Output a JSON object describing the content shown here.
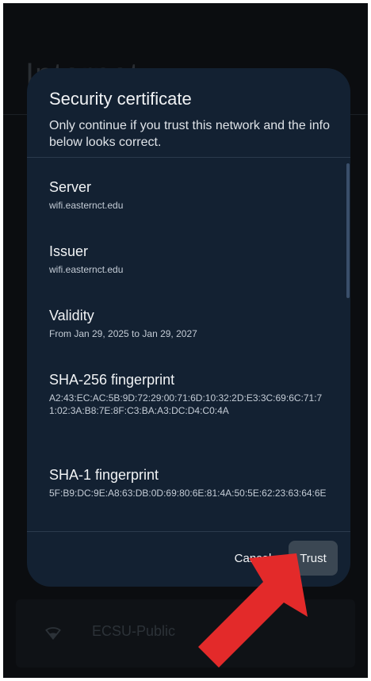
{
  "background": {
    "page_title": "Internet",
    "network_name": "ECSU-Public",
    "wifi_icon": "wifi-icon"
  },
  "dialog": {
    "title": "Security certificate",
    "subtitle": "Only continue if you trust this network and the info below looks correct.",
    "fields": [
      {
        "label": "Server",
        "value": "wifi.easternct.edu"
      },
      {
        "label": "Issuer",
        "value": "wifi.easternct.edu"
      },
      {
        "label": "Validity",
        "value": "From Jan 29, 2025 to Jan 29, 2027"
      },
      {
        "label": "SHA-256 fingerprint",
        "value": "A2:43:EC:AC:5B:9D:72:29:00:71:6D:10:32:2D:E3:3C:69:6C:71:71:02:3A:B8:7E:8F:C3:BA:A3:DC:D4:C0:4A"
      },
      {
        "label": "SHA-1 fingerprint",
        "value": "5F:B9:DC:9E:A8:63:DB:0D:69:80:6E:81:4A:50:5E:62:23:63:64:6E"
      }
    ],
    "buttons": {
      "cancel": "Cancel",
      "trust": "Trust"
    }
  },
  "annotation": {
    "arrow_color": "#e32a2a",
    "arrow_icon": "arrow-icon"
  },
  "colors": {
    "dialog_bg": "#132132",
    "trust_button_bg": "#3b4753"
  }
}
